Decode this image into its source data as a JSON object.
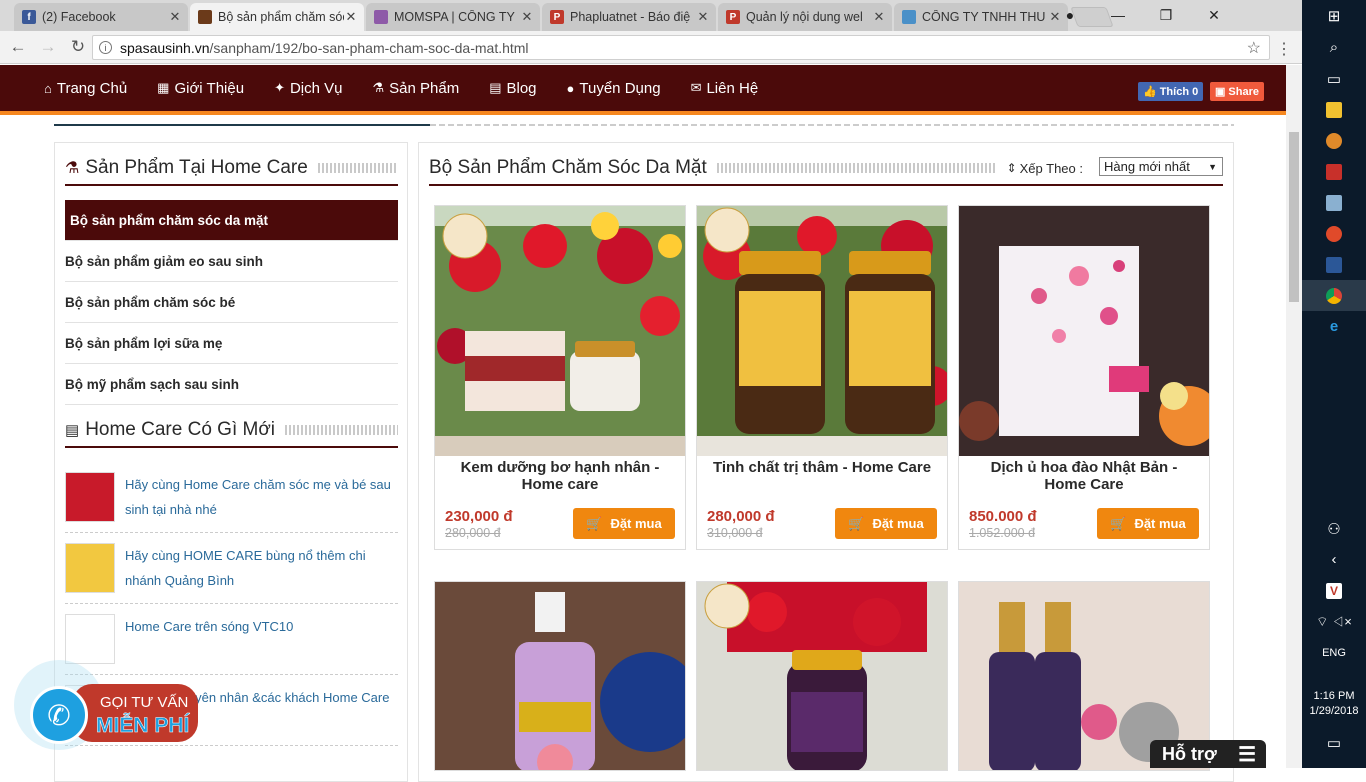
{
  "browser": {
    "tabs": [
      {
        "title": "(2) Facebook",
        "fav": "f",
        "fav_color": "#3b5998"
      },
      {
        "title": "Bộ sản phẩm chăm sóc",
        "fav": "",
        "fav_color": "#6b3a1a",
        "active": true
      },
      {
        "title": "MOMSPA | CÔNG TY",
        "fav": "",
        "fav_color": "#8e5aa8"
      },
      {
        "title": "Phapluatnet - Báo điệ",
        "fav": "P",
        "fav_color": "#c0392b"
      },
      {
        "title": "Quản lý nội dung wel",
        "fav": "P",
        "fav_color": "#c0392b"
      },
      {
        "title": "CÔNG TY TNHH THU",
        "fav": "",
        "fav_color": "#4a90c8"
      }
    ],
    "url_domain": "spasausinh.vn",
    "url_path": "/sanpham/192/bo-san-pham-cham-soc-da-mat.html"
  },
  "nav": {
    "items": [
      {
        "label": "Trang Chủ",
        "icon": "home-icon"
      },
      {
        "label": "Giới Thiệu",
        "icon": "building-icon"
      },
      {
        "label": "Dịch Vụ",
        "icon": "pin-icon"
      },
      {
        "label": "Sản Phẩm",
        "icon": "flask-icon"
      },
      {
        "label": "Blog",
        "icon": "newspaper-icon"
      },
      {
        "label": "Tuyển Dụng",
        "icon": "user-icon"
      },
      {
        "label": "Liên Hệ",
        "icon": "envelope-icon"
      }
    ],
    "fb_like": "Thích 0",
    "fb_share": "Share"
  },
  "sidebar": {
    "title": "Sản Phẩm Tại Home Care",
    "categories": [
      "Bộ sản phẩm chăm sóc da mặt",
      "Bộ sản phẩm giảm eo sau sinh",
      "Bộ sản phẩm chăm sóc bé",
      "Bộ sản phẩm lợi sữa mẹ",
      "Bộ mỹ phẩm sạch sau sinh"
    ],
    "news_title": "Home Care Có Gì Mới",
    "news": [
      "Hãy cùng Home Care chăm sóc mẹ và bé sau sinh tại nhà nhé",
      "Hãy cùng HOME CARE bùng nổ thêm chi nhánh Quảng Bình",
      "Home Care trên sóng VTC10",
      "u sinh - Nguyên nhân &các khách Home Care"
    ]
  },
  "main": {
    "title": "Bộ Sản Phẩm Chăm Sóc Da Mặt",
    "sort_label": "Xếp Theo :",
    "sort_value": "Hàng mới nhất",
    "buy_label": "Đặt mua",
    "products": [
      {
        "name": "Kem dưỡng bơ hạnh nhân - Home care",
        "price": "230,000 đ",
        "old": "280,000 đ"
      },
      {
        "name": "Tinh chất trị thâm - Home Care",
        "price": "280,000 đ",
        "old": "310,000 đ"
      },
      {
        "name": "Dịch ủ hoa đào Nhật Bản - Home Care",
        "price": "850.000 đ",
        "old": "1.052.000 đ"
      }
    ]
  },
  "floating": {
    "call_line1": "GỌI TƯ VẤN",
    "call_line2": "MIỄN PHÍ",
    "support": "Hỗ trợ"
  },
  "taskbar": {
    "time": "1:16 PM",
    "date": "1/29/2018",
    "lang": "ENG"
  }
}
